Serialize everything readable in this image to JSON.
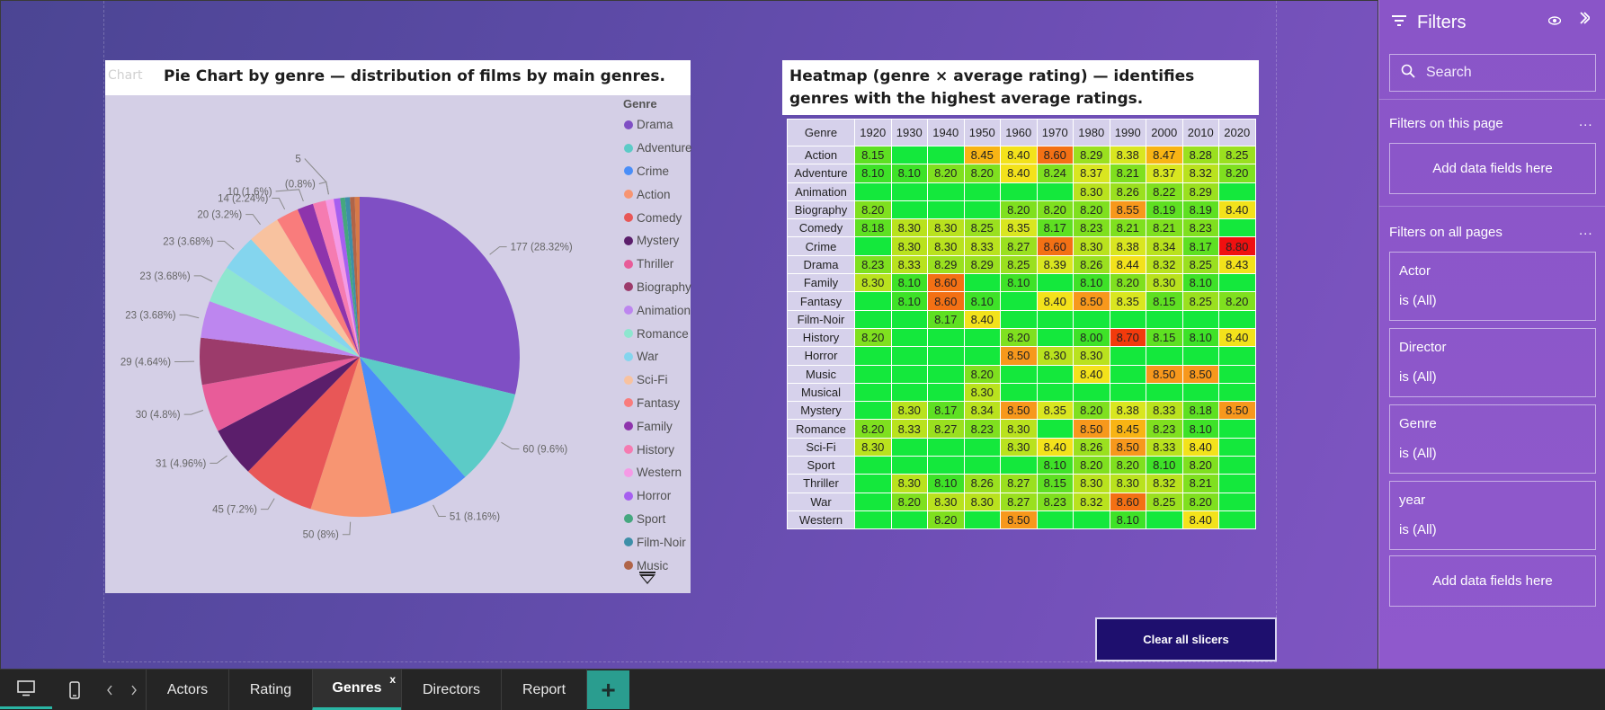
{
  "colors": {
    "canvas_start": "#4b4593",
    "canvas_end": "#7f55c2",
    "filters_bg": "#8a55c8",
    "accent_teal": "#2ab5a4",
    "button_dark": "#1e0f6e"
  },
  "pie_visual": {
    "header_clip": "Chart",
    "title": "Pie Chart by genre — distribution of films by main genres.",
    "legend_title": "Genre"
  },
  "heatmap_visual": {
    "title": "Heatmap (genre × average rating) — identifies genres with the highest average ratings."
  },
  "chart_data": [
    {
      "type": "pie",
      "title": "Pie Chart by genre — distribution of films by main genres.",
      "legend_title": "Genre",
      "legend_position": "right",
      "slices": [
        {
          "label": "Drama",
          "value": 177,
          "percent": 28.32,
          "color": "#7f4fc4"
        },
        {
          "label": "Adventure",
          "value": 60,
          "percent": 9.6,
          "color": "#5ccbc7"
        },
        {
          "label": "Crime",
          "value": 51,
          "percent": 8.16,
          "color": "#4a8ef8"
        },
        {
          "label": "Action",
          "value": 50,
          "percent": 8.0,
          "color": "#f79572"
        },
        {
          "label": "Comedy",
          "value": 45,
          "percent": 7.2,
          "color": "#e85757"
        },
        {
          "label": "Mystery",
          "value": 31,
          "percent": 4.96,
          "color": "#5b1e6b"
        },
        {
          "label": "Thriller",
          "value": 30,
          "percent": 4.8,
          "color": "#e85c99"
        },
        {
          "label": "Biography",
          "value": 29,
          "percent": 4.64,
          "color": "#9c3b6b"
        },
        {
          "label": "Animation",
          "value": 23,
          "percent": 3.68,
          "color": "#bd86ef"
        },
        {
          "label": "Romance",
          "value": 23,
          "percent": 3.68,
          "color": "#8ee6cf"
        },
        {
          "label": "War",
          "value": 23,
          "percent": 3.68,
          "color": "#84d5ee"
        },
        {
          "label": "Sci-Fi",
          "value": 20,
          "percent": 3.2,
          "color": "#f8c29f"
        },
        {
          "label": "Fantasy",
          "value": 14,
          "percent": 2.24,
          "color": "#f97c7c"
        },
        {
          "label": "Family",
          "value": 10,
          "percent": 1.6,
          "color": "#8e34ac"
        },
        {
          "label": "History",
          "value": 8,
          "percent": 1.28,
          "color": "#f57bb1"
        },
        {
          "label": "Western",
          "value": 5,
          "percent": 0.8,
          "color": "#f59ae6"
        },
        {
          "label": "Horror",
          "value": 4,
          "percent": 0.64,
          "color": "#a65ff0"
        },
        {
          "label": "Sport",
          "value": 3,
          "percent": 0.48,
          "color": "#45a77f"
        },
        {
          "label": "Film-Noir",
          "value": 3,
          "percent": 0.48,
          "color": "#3d8fa8"
        },
        {
          "label": "Music",
          "value": 3,
          "percent": 0.48,
          "color": "#b06448"
        },
        {
          "label": "Musical",
          "value": 3,
          "percent": 0.48,
          "color": "#d77a48"
        }
      ],
      "data_labels": [
        {
          "slice": "Drama",
          "text": "177 (28.32%)"
        },
        {
          "slice": "Adventure",
          "text": "60 (9.6%)"
        },
        {
          "slice": "Crime",
          "text": "51 (8.16%)"
        },
        {
          "slice": "Action",
          "text": "50 (8%)"
        },
        {
          "slice": "Comedy",
          "text": "45 (7.2%)"
        },
        {
          "slice": "Mystery",
          "text": "31 (4.96%)"
        },
        {
          "slice": "Thriller",
          "text": "30 (4.8%)"
        },
        {
          "slice": "Biography",
          "text": "29 (4.64%)"
        },
        {
          "slice": "Animation",
          "text": "23 (3.68%)"
        },
        {
          "slice": "Romance",
          "text": "23 (3.68%)"
        },
        {
          "slice": "War",
          "text": "23 (3.68%)"
        },
        {
          "slice": "Sci-Fi",
          "text": "20 (3.2%)"
        },
        {
          "slice": "Fantasy",
          "text": "14 (2.24%)"
        },
        {
          "slice": "Family",
          "text": "10 (1.6%)"
        },
        {
          "slice": "Western",
          "text": "(0.8%)"
        },
        {
          "slice": "Western",
          "text": "5"
        }
      ]
    },
    {
      "type": "heatmap",
      "title": "Heatmap (genre × average rating) — identifies genres with the highest average ratings.",
      "row_header": "Genre",
      "columns": [
        "1920",
        "1930",
        "1940",
        "1950",
        "1960",
        "1970",
        "1980",
        "1990",
        "2000",
        "2010",
        "2020"
      ],
      "rows": [
        {
          "genre": "Action",
          "values": [
            8.15,
            null,
            null,
            8.45,
            8.4,
            8.6,
            8.29,
            8.38,
            8.47,
            8.28,
            8.25
          ]
        },
        {
          "genre": "Adventure",
          "values": [
            8.1,
            8.1,
            8.2,
            8.2,
            8.4,
            8.24,
            8.37,
            8.21,
            8.37,
            8.32,
            8.2
          ]
        },
        {
          "genre": "Animation",
          "values": [
            null,
            null,
            null,
            null,
            null,
            null,
            8.3,
            8.26,
            8.22,
            8.29,
            null
          ]
        },
        {
          "genre": "Biography",
          "values": [
            8.2,
            null,
            null,
            null,
            8.2,
            8.2,
            8.2,
            8.55,
            8.19,
            8.19,
            8.4
          ]
        },
        {
          "genre": "Comedy",
          "values": [
            8.18,
            8.3,
            8.3,
            8.25,
            8.35,
            8.17,
            8.23,
            8.21,
            8.21,
            8.23,
            null
          ]
        },
        {
          "genre": "Crime",
          "values": [
            null,
            8.3,
            8.3,
            8.33,
            8.27,
            8.6,
            8.3,
            8.38,
            8.34,
            8.17,
            8.8
          ]
        },
        {
          "genre": "Drama",
          "values": [
            8.23,
            8.33,
            8.29,
            8.29,
            8.25,
            8.39,
            8.26,
            8.44,
            8.32,
            8.25,
            8.43
          ]
        },
        {
          "genre": "Family",
          "values": [
            8.3,
            8.1,
            8.6,
            null,
            8.1,
            null,
            8.1,
            8.2,
            8.3,
            8.1,
            null
          ]
        },
        {
          "genre": "Fantasy",
          "values": [
            null,
            8.1,
            8.6,
            8.1,
            null,
            8.4,
            8.5,
            8.35,
            8.15,
            8.25,
            8.2
          ]
        },
        {
          "genre": "Film-Noir",
          "values": [
            null,
            null,
            8.17,
            8.4,
            null,
            null,
            null,
            null,
            null,
            null,
            null
          ]
        },
        {
          "genre": "History",
          "values": [
            8.2,
            null,
            null,
            null,
            8.2,
            null,
            8.0,
            8.7,
            8.15,
            8.1,
            8.4
          ]
        },
        {
          "genre": "Horror",
          "values": [
            null,
            null,
            null,
            null,
            8.5,
            8.3,
            8.3,
            null,
            null,
            null,
            null
          ]
        },
        {
          "genre": "Music",
          "values": [
            null,
            null,
            null,
            8.2,
            null,
            null,
            8.4,
            null,
            8.5,
            8.5,
            null
          ]
        },
        {
          "genre": "Musical",
          "values": [
            null,
            null,
            null,
            8.3,
            null,
            null,
            null,
            null,
            null,
            null,
            null
          ]
        },
        {
          "genre": "Mystery",
          "values": [
            null,
            8.3,
            8.17,
            8.34,
            8.5,
            8.35,
            8.2,
            8.38,
            8.33,
            8.18,
            8.5
          ]
        },
        {
          "genre": "Romance",
          "values": [
            8.2,
            8.33,
            8.27,
            8.23,
            8.3,
            null,
            8.5,
            8.45,
            8.23,
            8.1,
            null
          ]
        },
        {
          "genre": "Sci-Fi",
          "values": [
            8.3,
            null,
            null,
            null,
            8.3,
            8.4,
            8.26,
            8.5,
            8.33,
            8.4,
            null
          ]
        },
        {
          "genre": "Sport",
          "values": [
            null,
            null,
            null,
            null,
            null,
            8.1,
            8.2,
            8.2,
            8.1,
            8.2,
            null
          ]
        },
        {
          "genre": "Thriller",
          "values": [
            null,
            8.3,
            8.1,
            8.26,
            8.27,
            8.15,
            8.3,
            8.3,
            8.32,
            8.21,
            null
          ]
        },
        {
          "genre": "War",
          "values": [
            null,
            8.2,
            8.3,
            8.3,
            8.27,
            8.23,
            8.32,
            8.6,
            8.25,
            8.2,
            null
          ]
        },
        {
          "genre": "Western",
          "values": [
            null,
            null,
            8.2,
            null,
            8.5,
            null,
            null,
            8.1,
            null,
            8.4,
            null
          ]
        }
      ]
    }
  ],
  "clear_button": {
    "label": "Clear all slicers"
  },
  "filters_pane": {
    "title": "Filters",
    "search_placeholder": "Search",
    "this_page_label": "Filters on this page",
    "all_pages_label": "Filters on all pages",
    "more_label": "...",
    "add_fields_label": "Add data fields here",
    "cards": [
      {
        "name": "Actor",
        "value": "is (All)"
      },
      {
        "name": "Director",
        "value": "is (All)"
      },
      {
        "name": "Genre",
        "value": "is (All)"
      },
      {
        "name": "year",
        "value": "is (All)"
      }
    ],
    "icons": {
      "filter": "filter-icon",
      "eye": "eye-icon",
      "collapse": "chevron-right-icon",
      "search": "search-icon"
    }
  },
  "tabs": {
    "items": [
      "Actors",
      "Rating",
      "Genres",
      "Directors",
      "Report"
    ],
    "active": "Genres",
    "close_label": "x",
    "add_label": "+"
  }
}
